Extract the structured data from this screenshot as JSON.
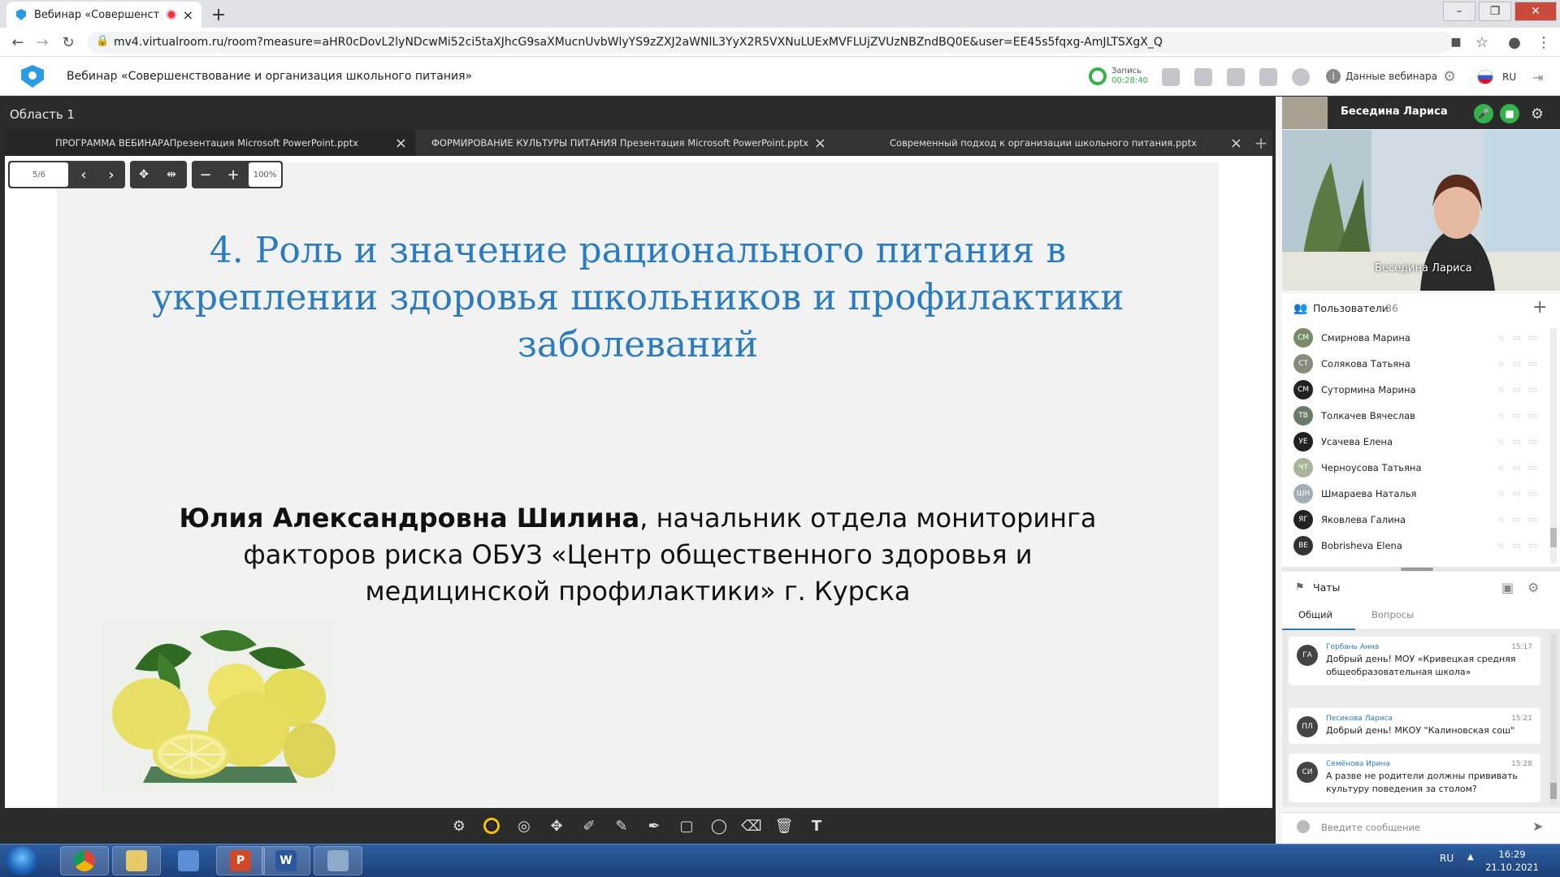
{
  "browser": {
    "tab_title": "Вебинар «Совершенствова",
    "url": "mv4.virtualroom.ru/room?measure=aHR0cDovL2lyNDcwMi52ci5taXJhcG9saXMucnUvbWlyYS9zZXJ2aWNlL3YyX2R5VXNuLUExMVFLUjZVUzNBZndBQ0E&user=EE45s5fqxg-AmJLTSXgX_Q"
  },
  "app": {
    "title": "Вебинар «Совершенствование и организация школьного питания»",
    "record_label": "Запись",
    "record_time": "00:28:40",
    "webinar_data_label": "Данные вебинара",
    "language": "RU"
  },
  "workspace": {
    "area_label": "Область 1",
    "file_tabs": [
      {
        "label": "ПРОГРАММА ВЕБИНАРАПрезентация Microsoft PowerPoint.pptx",
        "active": true
      },
      {
        "label": "ФОРМИРОВАНИЕ КУЛЬТУРЫ ПИТАНИЯ Презентация Microsoft PowerPoint.pptx",
        "active": false
      },
      {
        "label": "Современный подход к организации школьного питания.pptx",
        "active": false
      }
    ],
    "page_indicator": "5/6",
    "zoom": "100%"
  },
  "slide": {
    "title_lines": [
      "4. Роль и значение рационального питания в",
      "укреплении здоровья школьников и профилактики",
      "заболеваний"
    ],
    "speaker_name": "Юлия Александровна Шилина",
    "speaker_desc_1": ", начальник отдела мониторинга",
    "speaker_desc_2": "факторов риска ОБУЗ «Центр общественного здоровья и",
    "speaker_desc_3": "медицинской профилактики» г. Курска"
  },
  "video": {
    "presenter_name": "Беседина Лариса",
    "caption": "Беседина Лариса"
  },
  "users": {
    "label": "Пользователи",
    "count": "86",
    "list": [
      {
        "initials": "СМ",
        "name": "Смирнова Марина",
        "color": "#7a8b6a"
      },
      {
        "initials": "СТ",
        "name": "Солякова Татьяна",
        "color": "#8a8a7a"
      },
      {
        "initials": "СМ",
        "name": "Сутормина Марина",
        "color": "#222222"
      },
      {
        "initials": "ТВ",
        "name": "Толкачев Вячеслав",
        "color": "#6a7a6a"
      },
      {
        "initials": "УЕ",
        "name": "Усачева Елена",
        "color": "#222222"
      },
      {
        "initials": "ЧТ",
        "name": "Черноусова Татьяна",
        "color": "#a9b59a"
      },
      {
        "initials": "ШН",
        "name": "Шмараева Наталья",
        "color": "#a0aeb6"
      },
      {
        "initials": "ЯГ",
        "name": "Яковлева Галина",
        "color": "#222222"
      },
      {
        "initials": "BE",
        "name": "Bobrisheva Elena",
        "color": "#333333"
      }
    ]
  },
  "chat": {
    "label": "Чаты",
    "tab_general": "Общий",
    "tab_questions": "Вопросы",
    "messages": [
      {
        "initials": "ГА",
        "author": "Горбань Анна",
        "time": "15:17",
        "text": "Добрый день! МОУ «Кривецкая средняя общеобразовательная школа»"
      },
      {
        "initials": "ПЛ",
        "author": "Песикова Лариса",
        "time": "15:21",
        "text": "Добрый день! МКОУ \"Калиновская сош\""
      },
      {
        "initials": "СИ",
        "author": "Семёнова Ирина",
        "time": "15:28",
        "text": "А разве не родители должны прививать культуру поведения за столом?"
      }
    ],
    "input_placeholder": "Введите сообщение"
  },
  "taskbar": {
    "lang": "RU",
    "time": "16:29",
    "date": "21.10.2021",
    "apps": [
      {
        "name": "chrome",
        "glyph": ""
      },
      {
        "name": "explorer",
        "glyph": ""
      },
      {
        "name": "computer",
        "glyph": ""
      },
      {
        "name": "powerpoint",
        "glyph": "P"
      },
      {
        "name": "word",
        "glyph": "W"
      },
      {
        "name": "paint",
        "glyph": ""
      }
    ]
  }
}
